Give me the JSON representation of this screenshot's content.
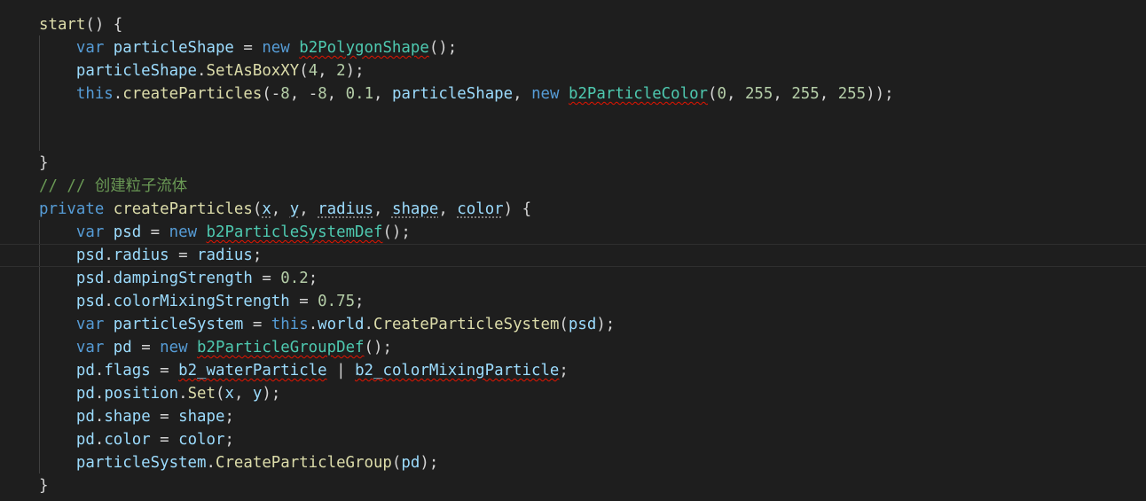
{
  "editor": {
    "language": "TypeScript",
    "colors": {
      "background": "#1e1e1e",
      "keyword": "#569cd6",
      "function": "#dcdcaa",
      "variable": "#9cdcfe",
      "type": "#4ec9b0",
      "number": "#b5cea8",
      "comment": "#6a9955",
      "plain": "#d4d4d4",
      "error_squiggle": "#e51400"
    },
    "lines": [
      [
        [
          "fn",
          "start"
        ],
        [
          "plain",
          "() {"
        ]
      ],
      [
        [
          "plain",
          "    "
        ],
        [
          "kw",
          "var "
        ],
        [
          "var",
          "particleShape"
        ],
        [
          "plain",
          " = "
        ],
        [
          "kw",
          "new "
        ],
        [
          "type",
          "b2PolygonShape",
          "err"
        ],
        [
          "plain",
          "();"
        ]
      ],
      [
        [
          "plain",
          "    "
        ],
        [
          "var",
          "particleShape"
        ],
        [
          "plain",
          "."
        ],
        [
          "fn",
          "SetAsBoxXY"
        ],
        [
          "plain",
          "("
        ],
        [
          "num",
          "4"
        ],
        [
          "plain",
          ", "
        ],
        [
          "num",
          "2"
        ],
        [
          "plain",
          ");"
        ]
      ],
      [
        [
          "plain",
          "    "
        ],
        [
          "kw",
          "this"
        ],
        [
          "plain",
          "."
        ],
        [
          "fn",
          "createParticles"
        ],
        [
          "plain",
          "(-"
        ],
        [
          "num",
          "8"
        ],
        [
          "plain",
          ", -"
        ],
        [
          "num",
          "8"
        ],
        [
          "plain",
          ", "
        ],
        [
          "num",
          "0.1"
        ],
        [
          "plain",
          ", "
        ],
        [
          "var",
          "particleShape"
        ],
        [
          "plain",
          ", "
        ],
        [
          "kw",
          "new "
        ],
        [
          "type",
          "b2ParticleColor",
          "err"
        ],
        [
          "plain",
          "("
        ],
        [
          "num",
          "0"
        ],
        [
          "plain",
          ", "
        ],
        [
          "num",
          "255"
        ],
        [
          "plain",
          ", "
        ],
        [
          "num",
          "255"
        ],
        [
          "plain",
          ", "
        ],
        [
          "num",
          "255"
        ],
        [
          "plain",
          "));"
        ]
      ],
      [],
      [],
      [
        [
          "plain",
          "}"
        ]
      ],
      [
        [
          "comment",
          "// // 创建粒子流体"
        ]
      ],
      [
        [
          "kw",
          "private "
        ],
        [
          "fn",
          "createParticles"
        ],
        [
          "plain",
          "("
        ],
        [
          "var",
          "x",
          "dot"
        ],
        [
          "plain",
          ", "
        ],
        [
          "var",
          "y",
          "dot"
        ],
        [
          "plain",
          ", "
        ],
        [
          "var",
          "radius",
          "dot"
        ],
        [
          "plain",
          ", "
        ],
        [
          "var",
          "shape",
          "dot"
        ],
        [
          "plain",
          ", "
        ],
        [
          "var",
          "color",
          "dot"
        ],
        [
          "plain",
          ") {"
        ]
      ],
      [
        [
          "plain",
          "    "
        ],
        [
          "kw",
          "var "
        ],
        [
          "var",
          "psd"
        ],
        [
          "plain",
          " = "
        ],
        [
          "kw",
          "new "
        ],
        [
          "type",
          "b2ParticleSystemDef",
          "err"
        ],
        [
          "plain",
          "();"
        ]
      ],
      [
        [
          "plain",
          "    "
        ],
        [
          "var",
          "psd"
        ],
        [
          "plain",
          "."
        ],
        [
          "var",
          "radius"
        ],
        [
          "plain",
          " = "
        ],
        [
          "var",
          "radius"
        ],
        [
          "plain",
          ";"
        ]
      ],
      [
        [
          "plain",
          "    "
        ],
        [
          "var",
          "psd"
        ],
        [
          "plain",
          "."
        ],
        [
          "var",
          "dampingStrength"
        ],
        [
          "plain",
          " = "
        ],
        [
          "num",
          "0.2"
        ],
        [
          "plain",
          ";"
        ]
      ],
      [
        [
          "plain",
          "    "
        ],
        [
          "var",
          "psd"
        ],
        [
          "plain",
          "."
        ],
        [
          "var",
          "colorMixingStrength"
        ],
        [
          "plain",
          " = "
        ],
        [
          "num",
          "0.75"
        ],
        [
          "plain",
          ";"
        ]
      ],
      [
        [
          "plain",
          "    "
        ],
        [
          "kw",
          "var "
        ],
        [
          "var",
          "particleSystem"
        ],
        [
          "plain",
          " = "
        ],
        [
          "kw",
          "this"
        ],
        [
          "plain",
          "."
        ],
        [
          "var",
          "world"
        ],
        [
          "plain",
          "."
        ],
        [
          "fn",
          "CreateParticleSystem"
        ],
        [
          "plain",
          "("
        ],
        [
          "var",
          "psd"
        ],
        [
          "plain",
          ");"
        ]
      ],
      [
        [
          "plain",
          "    "
        ],
        [
          "kw",
          "var "
        ],
        [
          "var",
          "pd"
        ],
        [
          "plain",
          " = "
        ],
        [
          "kw",
          "new "
        ],
        [
          "type",
          "b2ParticleGroupDef",
          "err"
        ],
        [
          "plain",
          "();"
        ]
      ],
      [
        [
          "plain",
          "    "
        ],
        [
          "var",
          "pd"
        ],
        [
          "plain",
          "."
        ],
        [
          "var",
          "flags"
        ],
        [
          "plain",
          " = "
        ],
        [
          "var",
          "b2_waterParticle",
          "err"
        ],
        [
          "plain",
          " | "
        ],
        [
          "var",
          "b2_colorMixingParticle",
          "err"
        ],
        [
          "plain",
          ";"
        ]
      ],
      [
        [
          "plain",
          "    "
        ],
        [
          "var",
          "pd"
        ],
        [
          "plain",
          "."
        ],
        [
          "var",
          "position"
        ],
        [
          "plain",
          "."
        ],
        [
          "fn",
          "Set"
        ],
        [
          "plain",
          "("
        ],
        [
          "var",
          "x"
        ],
        [
          "plain",
          ", "
        ],
        [
          "var",
          "y"
        ],
        [
          "plain",
          ");"
        ]
      ],
      [
        [
          "plain",
          "    "
        ],
        [
          "var",
          "pd"
        ],
        [
          "plain",
          "."
        ],
        [
          "var",
          "shape"
        ],
        [
          "plain",
          " = "
        ],
        [
          "var",
          "shape"
        ],
        [
          "plain",
          ";"
        ]
      ],
      [
        [
          "plain",
          "    "
        ],
        [
          "var",
          "pd"
        ],
        [
          "plain",
          "."
        ],
        [
          "var",
          "color"
        ],
        [
          "plain",
          " = "
        ],
        [
          "var",
          "color"
        ],
        [
          "plain",
          ";"
        ]
      ],
      [
        [
          "plain",
          "    "
        ],
        [
          "var",
          "particleSystem"
        ],
        [
          "plain",
          "."
        ],
        [
          "fn",
          "CreateParticleGroup"
        ],
        [
          "plain",
          "("
        ],
        [
          "var",
          "pd"
        ],
        [
          "plain",
          ");"
        ]
      ],
      [
        [
          "plain",
          "}"
        ]
      ]
    ]
  }
}
